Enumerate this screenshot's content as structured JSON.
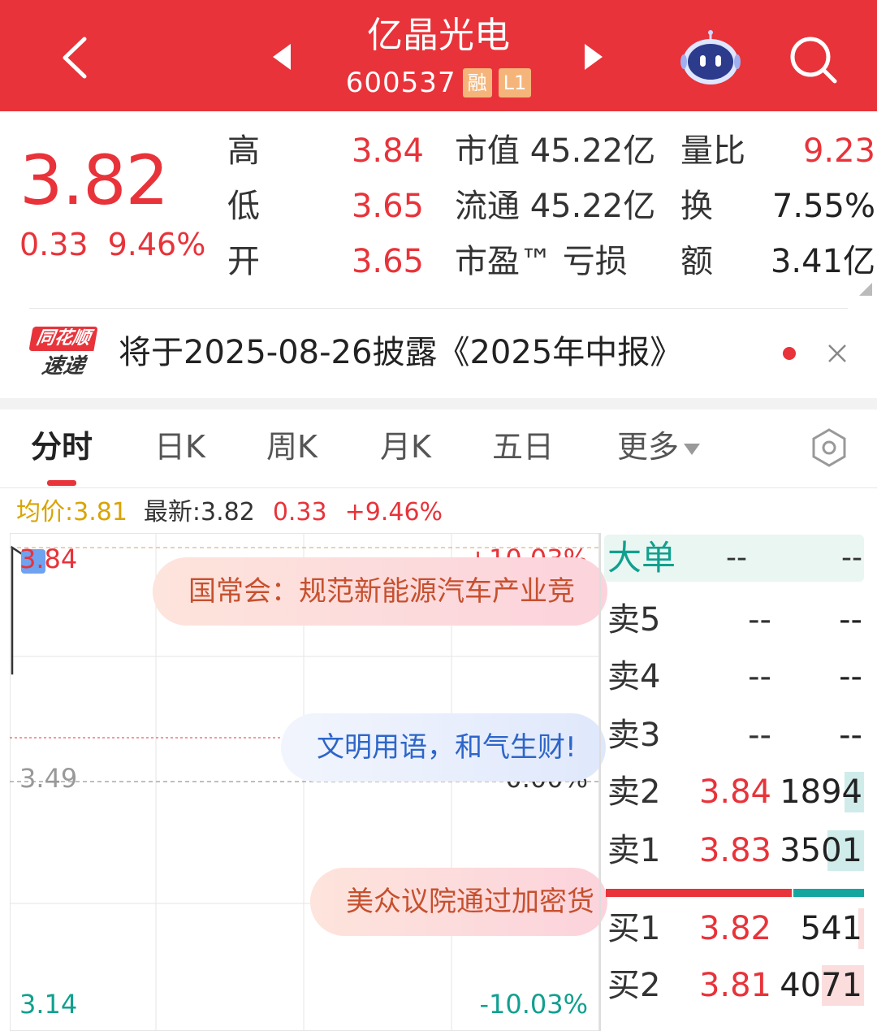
{
  "header": {
    "title": "亿晶光电",
    "code": "600537",
    "tags": [
      "融",
      "L1"
    ],
    "colors": {
      "bg": "#e8333a"
    }
  },
  "quote": {
    "price": "3.82",
    "change": "0.33",
    "change_pct": "9.46%",
    "rows": [
      {
        "label": "高",
        "value": "3.84",
        "label2": "市值",
        "value2": "45.22亿",
        "label3": "量比",
        "value3": "9.23"
      },
      {
        "label": "低",
        "value": "3.65",
        "label2": "流通",
        "value2": "45.22亿",
        "label3": "换",
        "value3": "7.55%"
      },
      {
        "label": "开",
        "value": "3.65",
        "label2": "市盈™",
        "value2": "亏损",
        "label3": "额",
        "value3": "3.41亿"
      }
    ]
  },
  "news": {
    "logo_top": "同花顺",
    "logo_bottom": "速递",
    "text": "将于2025-08-26披露《2025年中报》"
  },
  "tabs": [
    {
      "label": "分时",
      "active": true
    },
    {
      "label": "日K"
    },
    {
      "label": "周K"
    },
    {
      "label": "月K"
    },
    {
      "label": "五日"
    },
    {
      "label": "更多"
    }
  ],
  "infoline": {
    "avg": "均价:3.81",
    "latest": "最新:3.82",
    "change": "0.33",
    "change_pct": "+9.46%"
  },
  "chart": {
    "y_high": "3.84",
    "y_mid": "3.49",
    "y_low": "3.14",
    "pct_high": "+10.03%",
    "pct_mid": "0.00%",
    "pct_low": "-10.03%",
    "bubbles": [
      "国常会：规范新能源汽车产业竞",
      "文明用语，和气生财!",
      "美众议院通过加密货"
    ]
  },
  "chart_data": {
    "type": "line",
    "title": "",
    "xlabel": "",
    "ylabel": "",
    "ylim": [
      3.14,
      3.84
    ],
    "reference": 3.49,
    "series": [
      {
        "values": [
          3.65,
          3.84,
          3.82
        ]
      }
    ]
  },
  "order_book": {
    "big_order": {
      "label": "大单",
      "price": "--",
      "vol": "--"
    },
    "sell": [
      {
        "label": "卖5",
        "price": "--",
        "vol": "--"
      },
      {
        "label": "卖4",
        "price": "--",
        "vol": "--"
      },
      {
        "label": "卖3",
        "price": "--",
        "vol": "--"
      },
      {
        "label": "卖2",
        "price": "3.84",
        "vol": "1894",
        "bar": 0.35
      },
      {
        "label": "卖1",
        "price": "3.83",
        "vol": "3501",
        "bar": 0.64
      }
    ],
    "buy": [
      {
        "label": "买1",
        "price": "3.82",
        "vol": "541",
        "bar": 0.1
      },
      {
        "label": "买2",
        "price": "3.81",
        "vol": "4071",
        "bar": 0.75
      }
    ],
    "buy_sell_ratio": 0.72
  }
}
